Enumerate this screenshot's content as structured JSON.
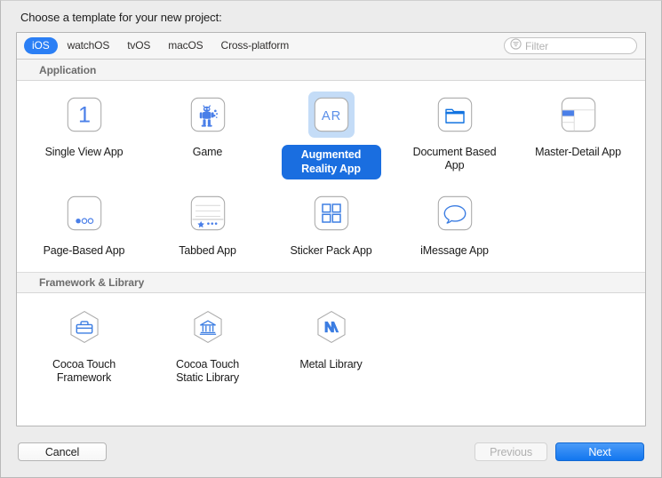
{
  "dialog": {
    "prompt": "Choose a template for your new project:"
  },
  "toolbar": {
    "tabs": [
      {
        "label": "iOS",
        "selected": true
      },
      {
        "label": "watchOS",
        "selected": false
      },
      {
        "label": "tvOS",
        "selected": false
      },
      {
        "label": "macOS",
        "selected": false
      },
      {
        "label": "Cross-platform",
        "selected": false
      }
    ],
    "filter": {
      "icon": "filter-icon",
      "value": "",
      "placeholder": "Filter"
    }
  },
  "sections": [
    {
      "title": "Application",
      "items": [
        {
          "label": "Single View App",
          "icon": "single-view-app-icon",
          "selected": false
        },
        {
          "label": "Game",
          "icon": "game-robot-icon",
          "selected": false
        },
        {
          "label": "Augmented Reality App",
          "icon": "augmented-reality-ar-icon",
          "selected": true
        },
        {
          "label": "Document Based App",
          "icon": "document-folder-icon",
          "selected": false
        },
        {
          "label": "Master-Detail App",
          "icon": "master-detail-split-icon",
          "selected": false
        },
        {
          "label": "Page-Based App",
          "icon": "page-dots-icon",
          "selected": false
        },
        {
          "label": "Tabbed App",
          "icon": "tab-bar-icon",
          "selected": false
        },
        {
          "label": "Sticker Pack App",
          "icon": "sticker-grid-icon",
          "selected": false
        },
        {
          "label": "iMessage App",
          "icon": "message-bubble-icon",
          "selected": false
        }
      ]
    },
    {
      "title": "Framework & Library",
      "items": [
        {
          "label": "Cocoa Touch Framework",
          "icon": "briefcase-hexagon-icon",
          "selected": false
        },
        {
          "label": "Cocoa Touch Static Library",
          "icon": "bank-hexagon-icon",
          "selected": false
        },
        {
          "label": "Metal Library",
          "icon": "metal-hexagon-icon",
          "selected": false
        }
      ]
    }
  ],
  "footer": {
    "cancel_label": "Cancel",
    "previous_label": "Previous",
    "next_label": "Next",
    "previous_disabled": true
  },
  "colors": {
    "accent_blue": "#2b7ff5",
    "selection_fill": "#c4dcf7",
    "selection_label": "#1a6ee0",
    "icon_blue": "#4a7fe8",
    "window_bg": "#ececec"
  }
}
